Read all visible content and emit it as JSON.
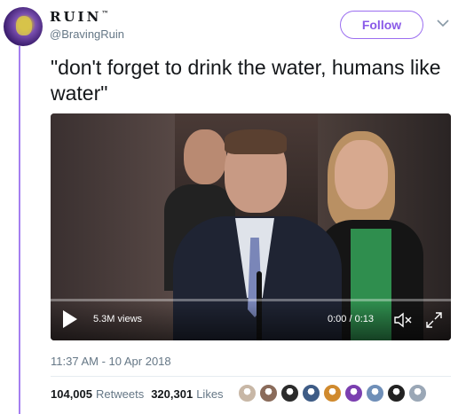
{
  "author": {
    "display_name": "RUIN",
    "tm": "™",
    "handle": "@BravingRuin"
  },
  "actions": {
    "follow_label": "Follow",
    "more_icon": "chevron-down-icon"
  },
  "tweet": {
    "text": "\"don't forget to drink the water, humans like water\""
  },
  "video": {
    "views": "5.3M views",
    "time": "0:00 / 0:13",
    "progress": 0,
    "icons": [
      "play-icon",
      "mute-icon",
      "fullscreen-icon"
    ]
  },
  "meta": {
    "timestamp": "11:37 AM - 10 Apr 2018"
  },
  "stats": {
    "retweets_count": "104,005",
    "retweets_label": "Retweets",
    "likes_count": "320,301",
    "likes_label": "Likes"
  },
  "likers": [
    {
      "color": "#c8b7a6"
    },
    {
      "color": "#8a6b5a"
    },
    {
      "color": "#2b2b2b"
    },
    {
      "color": "#3e5c86"
    },
    {
      "color": "#d08a2e"
    },
    {
      "color": "#7b3fb0"
    },
    {
      "color": "#6f8fb8"
    },
    {
      "color": "#222222"
    },
    {
      "color": "#9aa7b6"
    }
  ],
  "colors": {
    "accent": "#8a5ae8",
    "thread_line": "#a57ff0",
    "muted_text": "#657786"
  }
}
